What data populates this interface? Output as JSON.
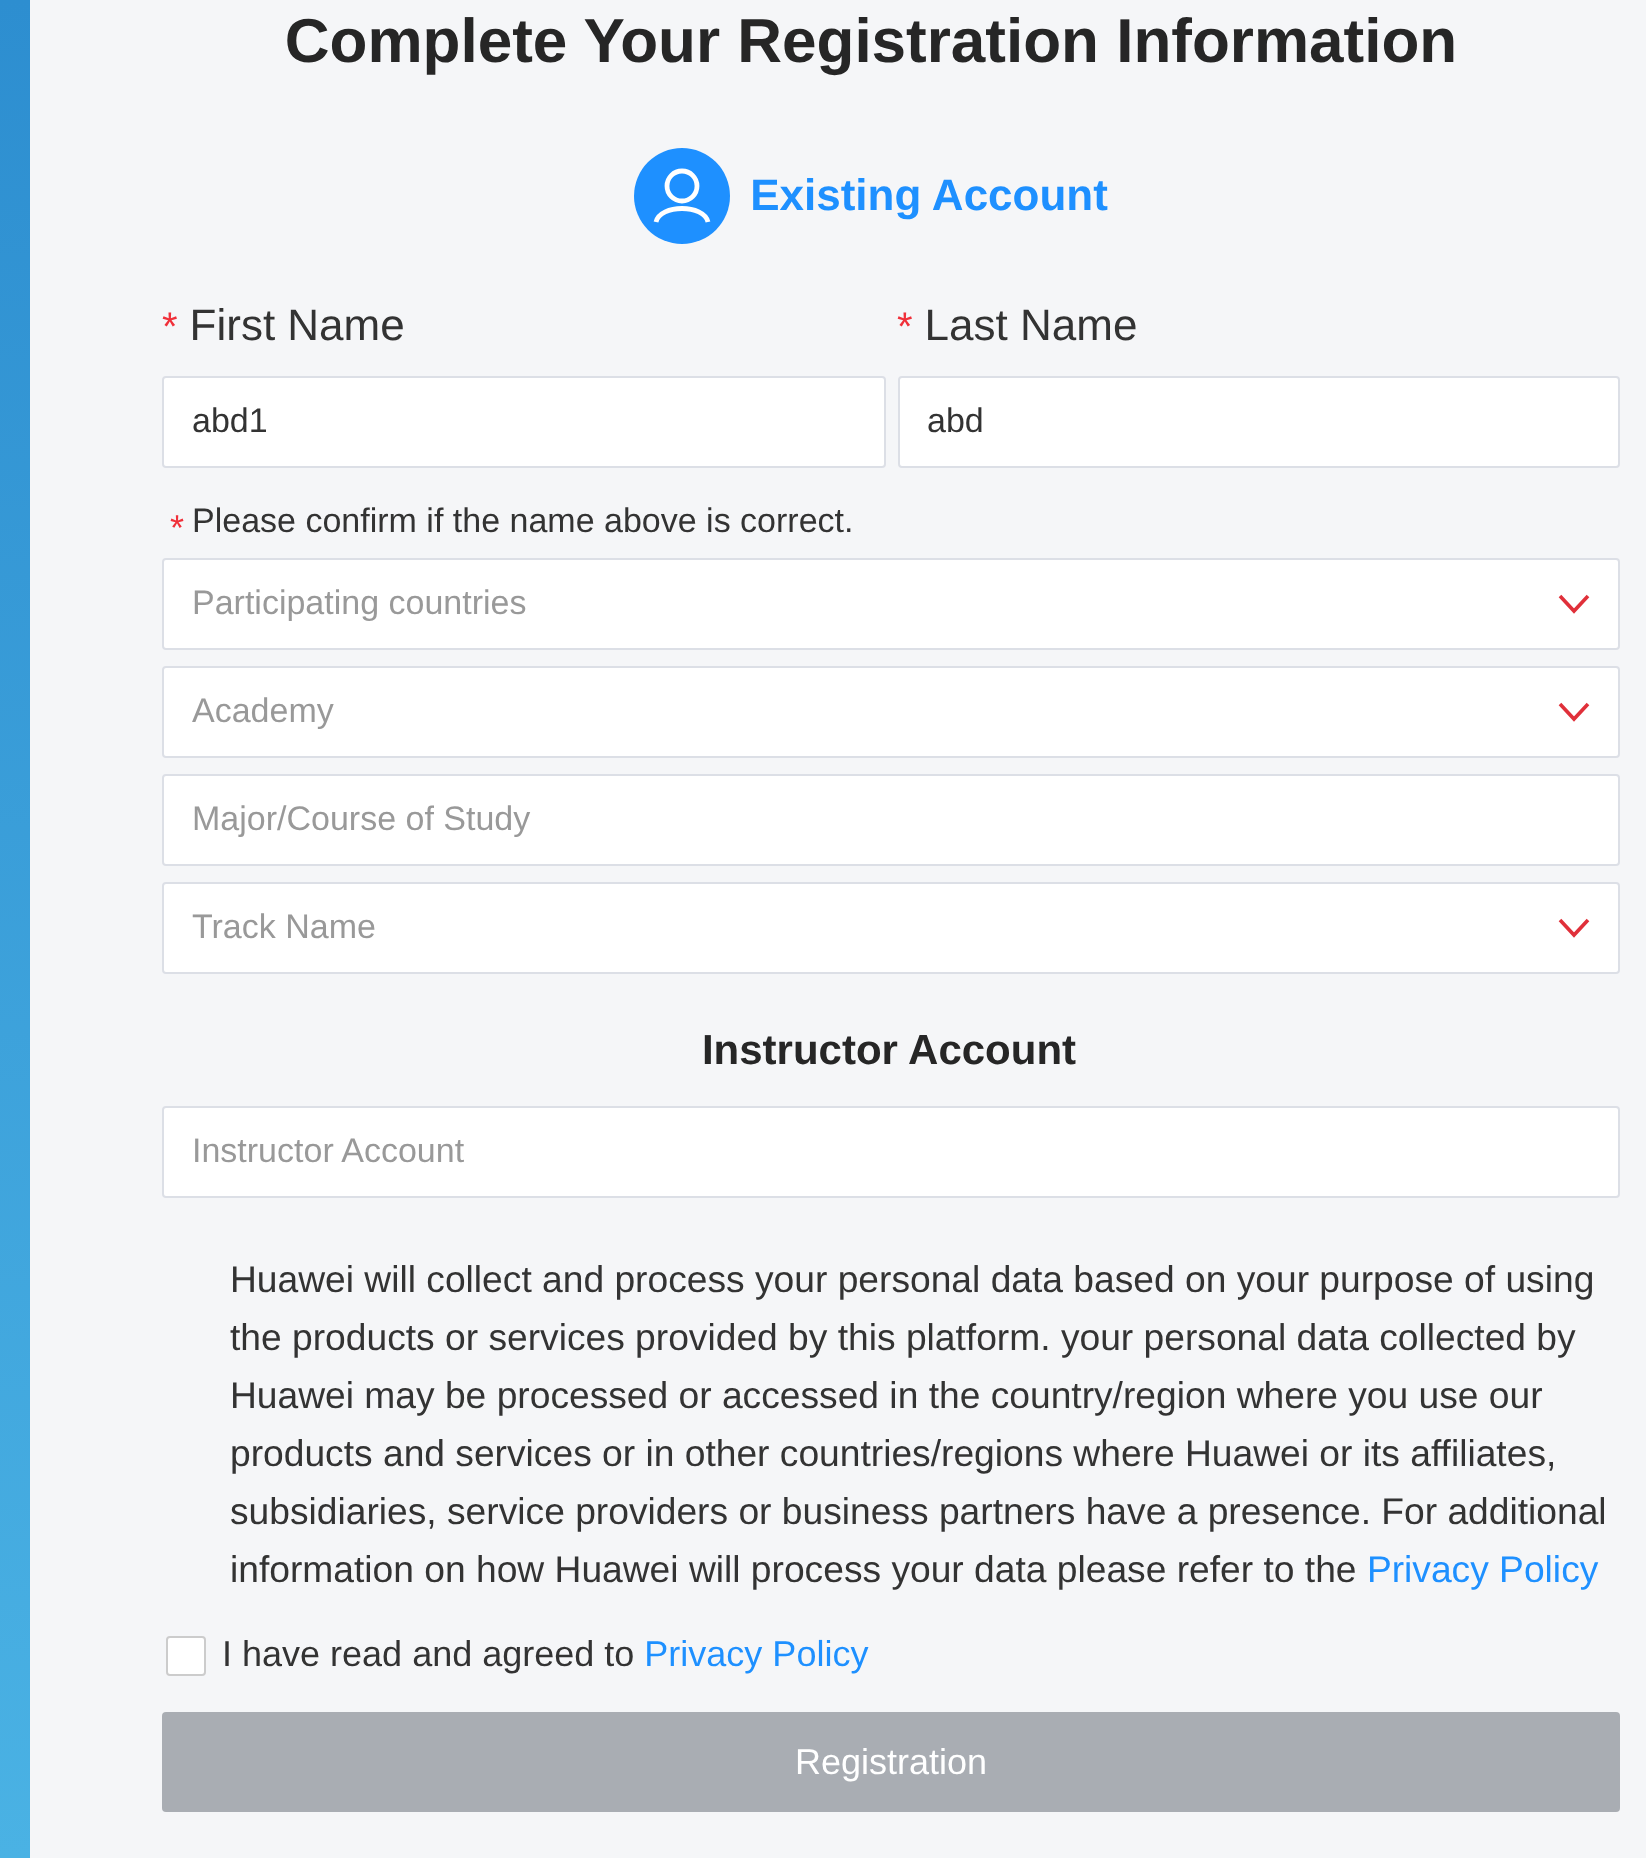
{
  "title": "Complete Your Registration Information",
  "account_switch": {
    "label": "Existing Account"
  },
  "required_mark": "*",
  "name_fields": [
    {
      "label": "First Name",
      "required": true,
      "value": "abd1"
    },
    {
      "label": "Last Name",
      "required": true,
      "value": "abd"
    }
  ],
  "name_note": {
    "text": "Please confirm if the name above is correct.",
    "required": true
  },
  "fields": [
    {
      "kind": "select",
      "placeholder": "Participating countries"
    },
    {
      "kind": "select",
      "placeholder": "Academy"
    },
    {
      "kind": "text",
      "placeholder": "Major/Course of Study"
    },
    {
      "kind": "select",
      "placeholder": "Track Name"
    }
  ],
  "instructor": {
    "heading": "Instructor Account",
    "placeholder": "Instructor Account"
  },
  "privacy_notice": {
    "text": "Huawei will collect and process your personal data based on your purpose of using the products or services provided by this platform. your personal data collected by Huawei may be processed or accessed in the country/region where you use our products and services or in other countries/regions where Huawei or its affiliates, subsidiaries, service providers or business partners have a presence. For additional information on how Huawei will process your data please refer to the",
    "link": "Privacy Policy"
  },
  "agreement": {
    "checked": false,
    "text": "I have read and agreed to",
    "link": "Privacy Policy"
  },
  "register_button": {
    "label": "Registration",
    "disabled": true
  }
}
